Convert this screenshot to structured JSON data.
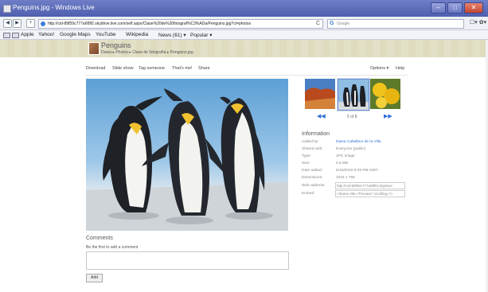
{
  "window": {
    "title": "Penguins.jpg - Windows Live"
  },
  "browser": {
    "url": "http://cid-89f59c777a6f9f2.skydrive.live.com/self.aspx/Clase%20de%20fotograf%C3%ADa/Penguins.jpg?ct=photos",
    "search_placeholder": "Google",
    "back_glyph": "◀",
    "forward_glyph": "▶",
    "add_glyph": "+",
    "search_logo": "G",
    "reload_glyph": "C",
    "tools_glyphs": "☐▾ ✿▾"
  },
  "bookmarks": [
    "Apple",
    "Yahoo!",
    "Google Maps",
    "YouTube",
    "Wikipedia",
    "News (61) ▾",
    "Popular ▾"
  ],
  "album": {
    "title": "Penguins",
    "breadcrumb": "Diana ▸ Photos ▸ Clase de fotografía ▸ Penguins.jpg"
  },
  "actions": {
    "download": "Download",
    "slideshow": "Slide show",
    "tag": "Tag someone",
    "thatsme": "That's me!",
    "share": "Share",
    "options": "Options ▾",
    "help": "Help"
  },
  "thumbs": {
    "counter": "5 of 8",
    "prev": "◀◀",
    "next": "▶▶"
  },
  "info": {
    "title": "Information",
    "rows": [
      {
        "label": "Added by:",
        "value": "Diana Caballero de la Villa"
      },
      {
        "label": "Shared with:",
        "value": "Everyone (public)"
      },
      {
        "label": "Type:",
        "value": "JPG image"
      },
      {
        "label": "Size:",
        "value": "0.5 MB"
      },
      {
        "label": "Date added:",
        "value": "5/16/2010 8:29 PM GMT"
      },
      {
        "label": "Dimensions:",
        "value": "1024 x 768"
      },
      {
        "label": "Web address:",
        "value": "http://cid-89f59c777a6f9f2.skydrive"
      },
      {
        "label": "Embed:",
        "value": "<iframe title=\"Preview\" scrolling=\"n"
      }
    ]
  },
  "comments": {
    "title": "Comments",
    "prompt": "Be the first to add a comment",
    "add_label": "Add"
  },
  "window_controls": {
    "min": "–",
    "max": "□",
    "close": "✕"
  }
}
